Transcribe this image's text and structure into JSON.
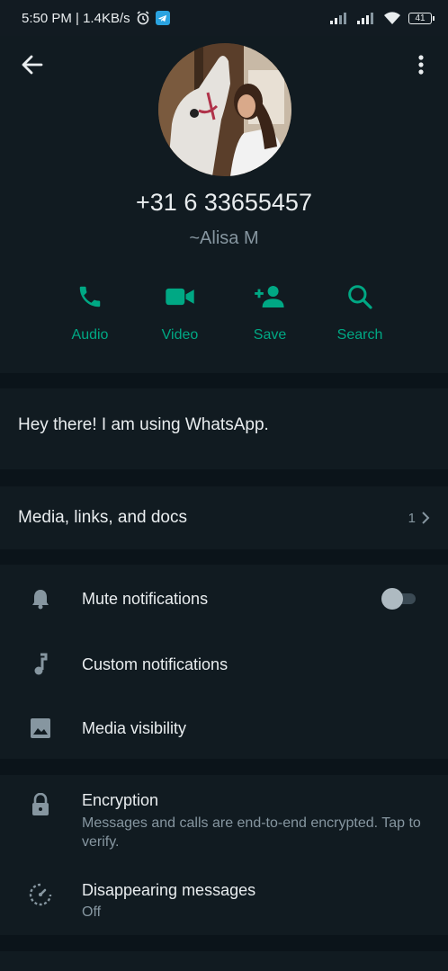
{
  "status_bar": {
    "time_speed": "5:50 PM | 1.4KB/s",
    "battery": "41"
  },
  "profile": {
    "phone": "+31 6 33655457",
    "alias": "~Alisa M"
  },
  "actions": [
    {
      "label": "Audio",
      "icon": "phone-icon"
    },
    {
      "label": "Video",
      "icon": "video-icon"
    },
    {
      "label": "Save",
      "icon": "add-contact-icon"
    },
    {
      "label": "Search",
      "icon": "search-icon"
    }
  ],
  "about": {
    "text": "Hey there! I am using WhatsApp."
  },
  "media": {
    "title": "Media, links, and docs",
    "count": "1"
  },
  "notifications": {
    "mute": "Mute notifications",
    "mute_enabled": false,
    "custom": "Custom notifications",
    "visibility": "Media visibility"
  },
  "privacy": {
    "encryption_title": "Encryption",
    "encryption_sub": "Messages and calls are end-to-end encrypted. Tap to verify.",
    "disappearing_title": "Disappearing messages",
    "disappearing_sub": "Off"
  },
  "colors": {
    "accent": "#00a884",
    "background": "#0b141a",
    "card": "#111b21",
    "secondary_text": "#8696a0"
  }
}
